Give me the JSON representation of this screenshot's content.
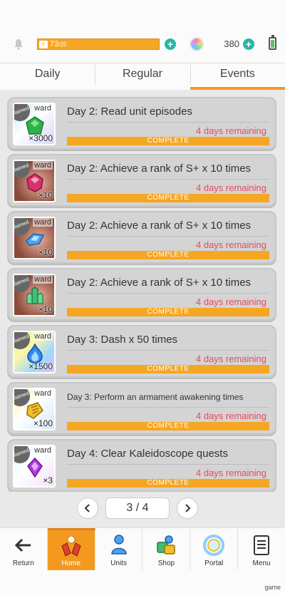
{
  "status": {
    "stamina_value": "73",
    "stamina_max": "/25",
    "gems": "380"
  },
  "tabs": [
    {
      "label": "Daily"
    },
    {
      "label": "Regular"
    },
    {
      "label": "Events",
      "active": true
    }
  ],
  "missions": [
    {
      "title": "Day 2: Read  unit episodes",
      "remaining": "4 days remaining",
      "status": "COMPLETE",
      "reward_label": "ward",
      "claimed_label": "Claimed",
      "qty": "×3000",
      "item": "green-gem-icon"
    },
    {
      "title": "Day 2: Achieve a rank of S+  x 10 times",
      "remaining": "4 days remaining",
      "status": "COMPLETE",
      "reward_label": "ward",
      "claimed_label": "Claimed",
      "qty": "×10",
      "item": "red-gem-icon"
    },
    {
      "title": "Day 2: Achieve a rank of S+  x 10 times",
      "remaining": "4 days remaining",
      "status": "COMPLETE",
      "reward_label": "ward",
      "claimed_label": "Claimed",
      "qty": "×10",
      "item": "blue-crystal-icon"
    },
    {
      "title": "Day 2: Achieve a rank of S+  x 10 times",
      "remaining": "4 days remaining",
      "status": "COMPLETE",
      "reward_label": "ward",
      "claimed_label": "Claimed",
      "qty": "×10",
      "item": "green-crystal-icon"
    },
    {
      "title": "Day 3: Dash  x 50 times",
      "remaining": "4 days remaining",
      "status": "COMPLETE",
      "reward_label": "ward",
      "claimed_label": "Claimed",
      "qty": "×1500",
      "item": "blue-flame-icon"
    },
    {
      "title": "Day 3: Perform an armament awakening  times",
      "remaining": "4 days remaining",
      "status": "COMPLETE",
      "reward_label": "ward",
      "claimed_label": "Claimed",
      "qty": "×100",
      "item": "gold-scroll-icon"
    },
    {
      "title": "Day 4: Clear  Kaleidoscope quests",
      "remaining": "4 days remaining",
      "status": "COMPLETE",
      "reward_label": "ward",
      "claimed_label": "Claimed",
      "qty": "×3",
      "item": "purple-gem-icon"
    }
  ],
  "pager": {
    "label": "3 / 4",
    "prev_icon": "chevron-left-icon",
    "next_icon": "chevron-right-icon"
  },
  "nav": [
    {
      "label": "Return",
      "icon": "arrow-left-icon"
    },
    {
      "label": "Home",
      "icon": "home-icon",
      "active": true
    },
    {
      "label": "Units",
      "icon": "units-icon"
    },
    {
      "label": "Shop",
      "icon": "shop-icon"
    },
    {
      "label": "Portal",
      "icon": "portal-icon"
    },
    {
      "label": "Menu",
      "icon": "menu-icon"
    }
  ],
  "watermark": "game",
  "colors": {
    "accent": "#f39a1e",
    "bar": "#f5a623",
    "remaining": "#e84a5f",
    "plus": "#26b7a4"
  }
}
